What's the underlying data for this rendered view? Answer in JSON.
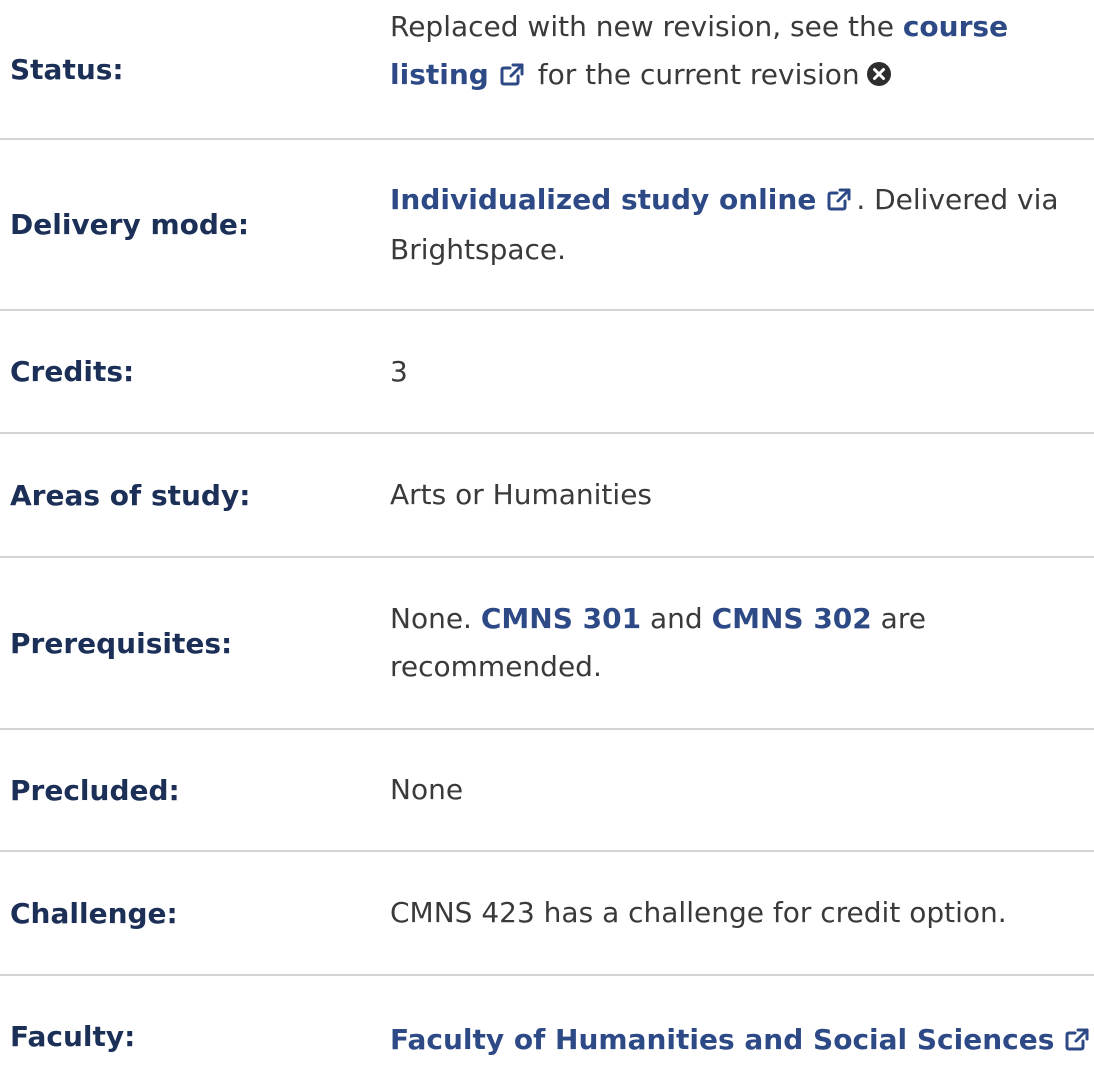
{
  "rows": {
    "status": {
      "label": "Status:",
      "text_before": "Replaced with new revision, see the ",
      "link_text": "course listing",
      "text_after": " for the current revision",
      "link_icon": "external-link-icon",
      "trailing_icon": "close-circle-icon"
    },
    "delivery": {
      "label": "Delivery mode:",
      "link_text": "Individualized study online",
      "link_icon": "external-link-icon",
      "text_after": ". Delivered via Brightspace."
    },
    "credits": {
      "label": "Credits:",
      "value": "3"
    },
    "areas": {
      "label": "Areas of study:",
      "value": "Arts or Humanities"
    },
    "prerequisites": {
      "label": "Prerequisites:",
      "text_before": "None. ",
      "link1_text": "CMNS 301",
      "text_middle": " and ",
      "link2_text": "CMNS 302",
      "text_after": " are recommended."
    },
    "precluded": {
      "label": "Precluded:",
      "value": "None"
    },
    "challenge": {
      "label": "Challenge:",
      "value": "CMNS 423 has a challenge for credit option."
    },
    "faculty": {
      "label": "Faculty:",
      "link_text": "Faculty of Humanities and Social Sciences",
      "link_icon": "external-link-icon"
    }
  },
  "colors": {
    "label": "#1b2f57",
    "link": "#2d4a86",
    "text": "#3a3a3a",
    "divider": "#d4d4d4"
  }
}
